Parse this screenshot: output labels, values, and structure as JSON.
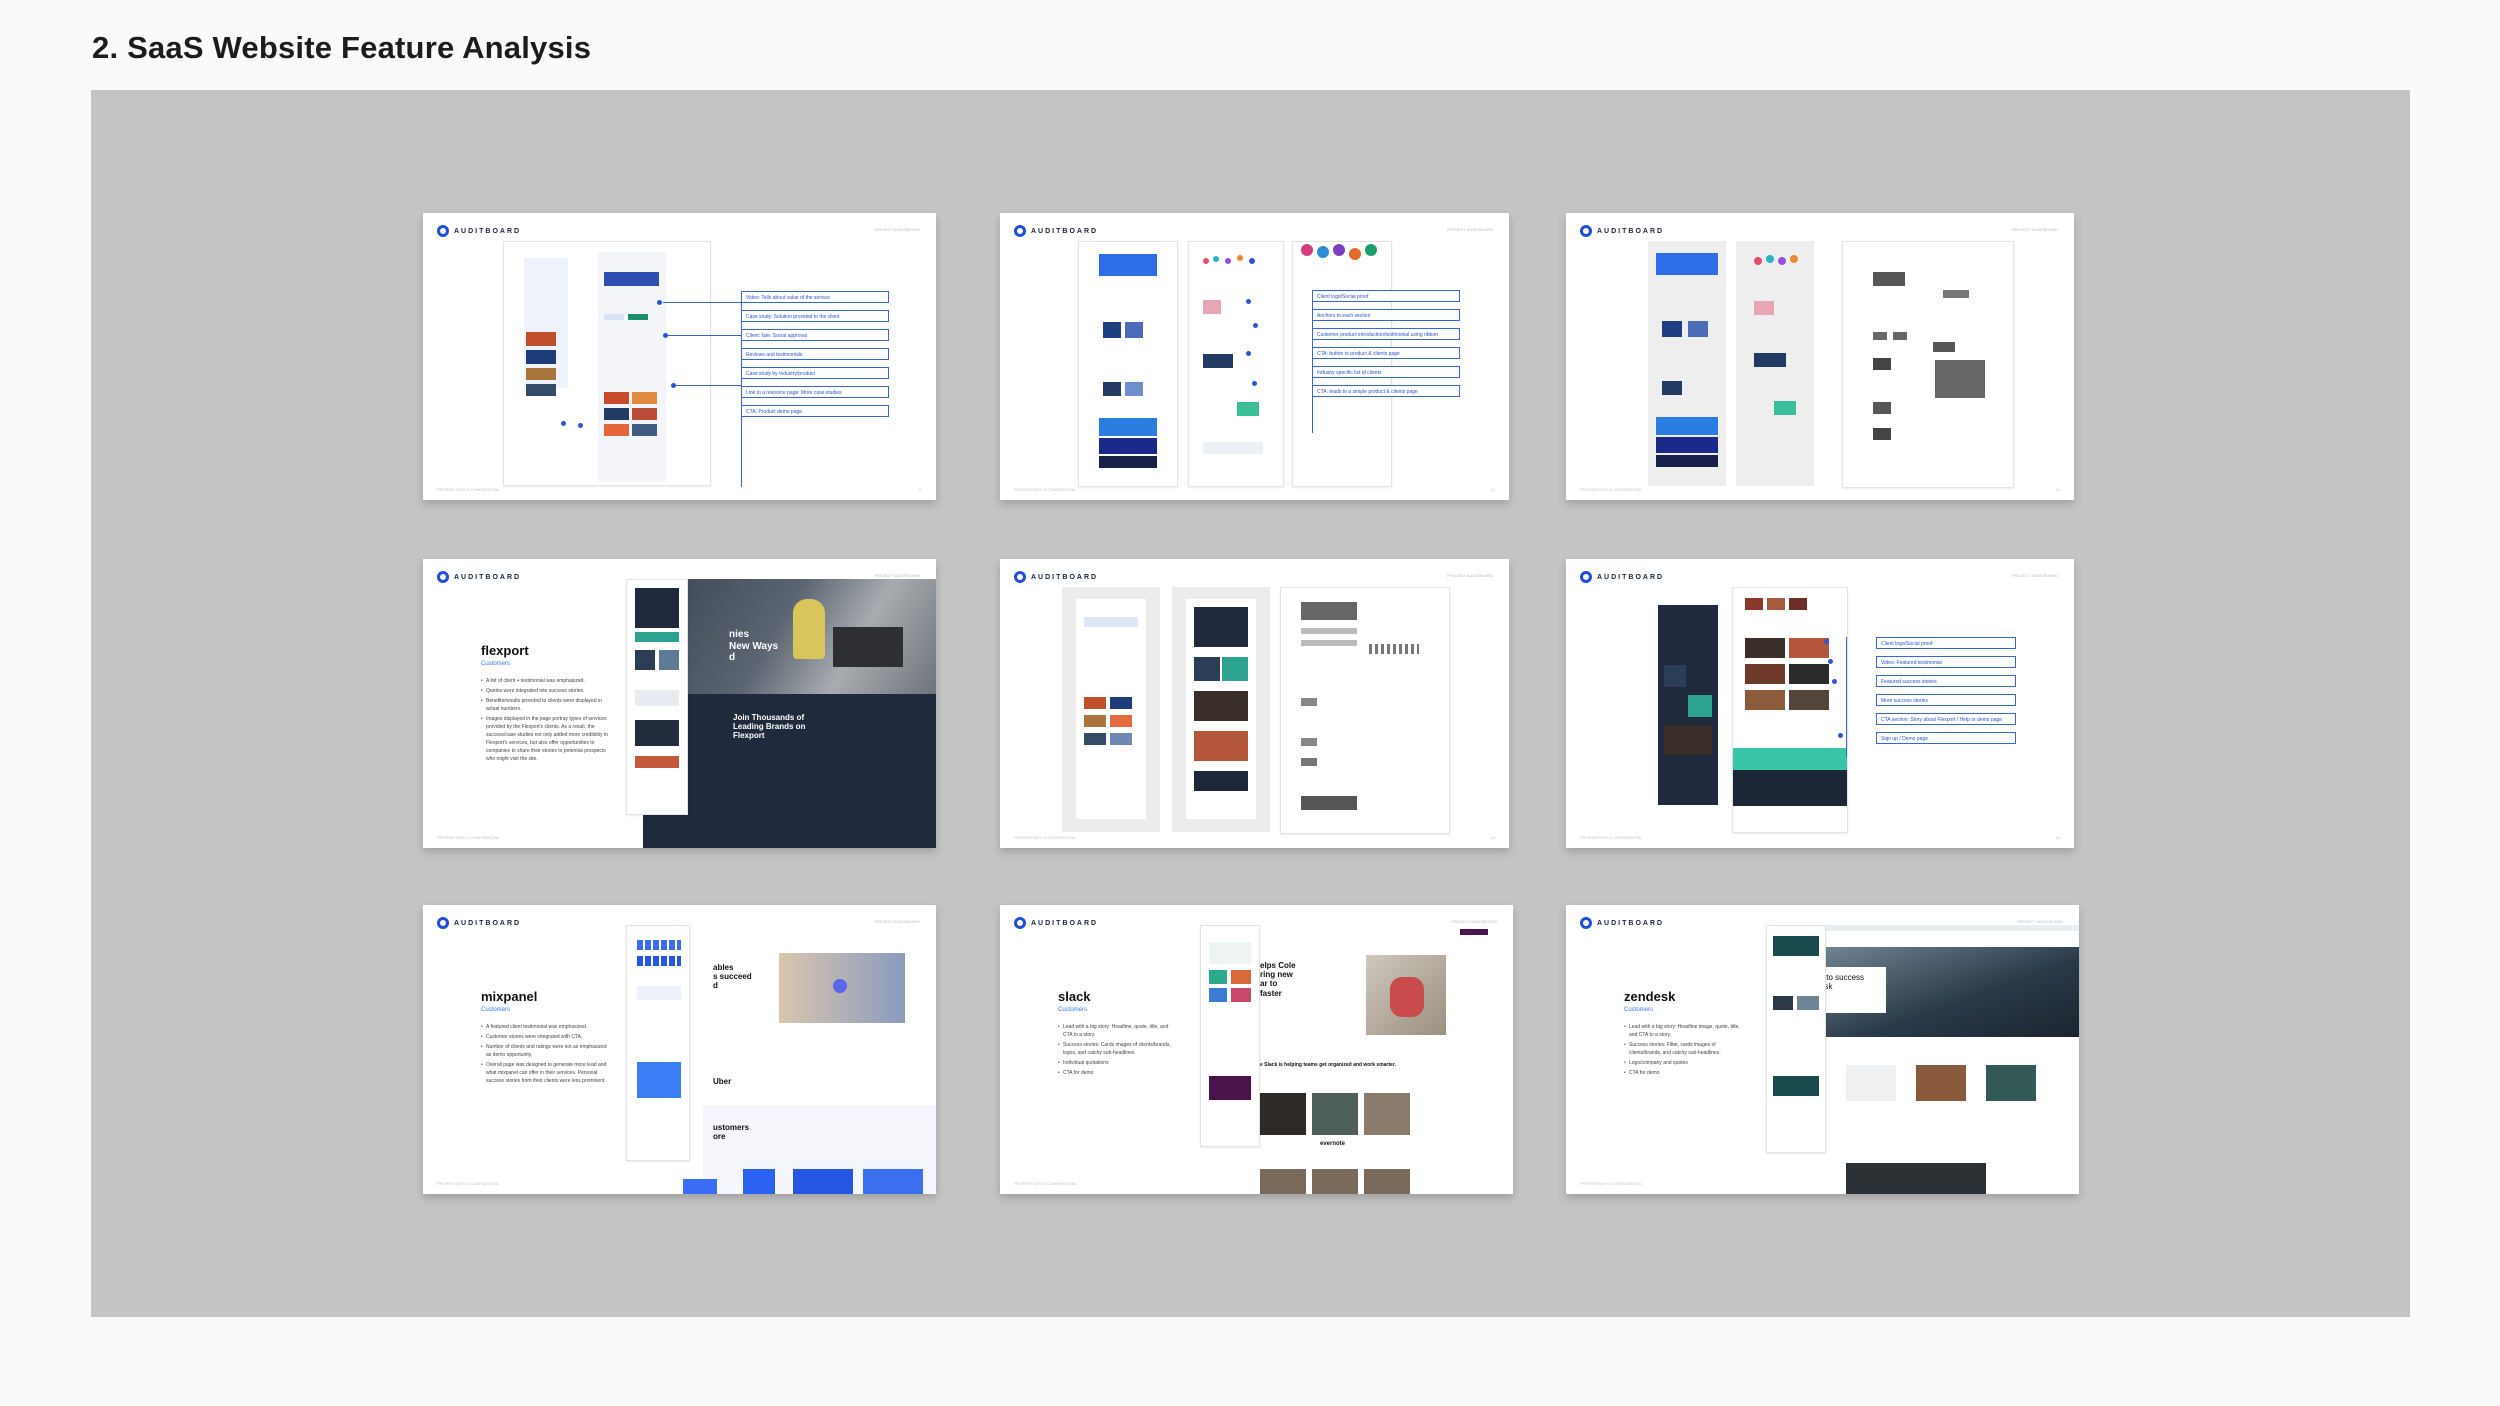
{
  "page": {
    "title": "2. SaaS Website Feature Analysis"
  },
  "slide_common": {
    "logo_text": "AUDITBOARD",
    "header_right": "PROJECT AUDITBOARD",
    "footer": "PROPRIETARY & CONFIDENTIAL"
  },
  "slides": {
    "s1": {
      "page_number": "11",
      "callouts": [
        "Video: Tells about value of the service",
        "Case study: Solution provided to the client",
        "Client: fate: Social approval",
        "Reviews and testimonials",
        "Case study by Industry/product",
        "Link to a resource page: More case studies",
        "CTA: Product demo page"
      ]
    },
    "s2": {
      "page_number": "12",
      "callouts": [
        "Client logo/Social proof",
        "Anchors to each section",
        "Customer product introduction/testimonial using ribbon",
        "CTA: button to product & clients page",
        "Industry specific list of clients",
        "CTA: leads to a simple product & clients page"
      ]
    },
    "s3": {
      "page_number": "13"
    },
    "s4": {
      "page_number": "14",
      "brand": "flexport",
      "subtitle": "Customers",
      "bullets": [
        "A list of client + testimonial was emphasized.",
        "Quotes were integrated into success stories.",
        "Benefits/results provided to clients were displayed in actual numbers.",
        "Images displayed in the page portray types of services provided by the Flexport's clients. As a result, the success/case studies not only added more credibility to Flexport's services, but also offer opportunities to companies to share their stories to potential prospects who might visit the site."
      ],
      "hero_text": "nies\nNew Ways\nd",
      "join_text": "Join Thousands of\nLeading Brands on\nFlexport"
    },
    "s5": {
      "page_number": "15"
    },
    "s6": {
      "page_number": "16",
      "callouts": [
        "Client logo/Social proof",
        "Video: Featured testimonial",
        "Featured success stories",
        "More success stories",
        "CTA section: Story about Flexport / Help or demo page",
        "Sign up / Demo page"
      ]
    },
    "s7": {
      "page_number": "17",
      "brand": "mixpanel",
      "subtitle": "Customers",
      "bullets": [
        "A featured client testimonial was emphasized.",
        "Customer stories were integrated with CTA.",
        "Number of clients and ratings were not as emphasized as demo opportunity.",
        "Overall page was designed to generate more lead and what mixpanel can offer in their services. Personal success stories from their clients were less prominent."
      ],
      "hero_text": "ables\ns succeed\nd",
      "stories_text": "ustomers\nore",
      "uber": "Uber"
    },
    "s8": {
      "page_number": "18",
      "brand": "slack",
      "subtitle": "Customers",
      "bullets": [
        "Lead with a big story: Headline, quote, title, and CTA to a story.",
        "Success stories: Cards images of clients/brands, logos, and catchy sub-headlines.",
        "Individual quotations",
        "CTA for demo"
      ],
      "hero_text": "elps Cole\nring new\nar to\nfaster",
      "helping_text": "e Slack is helping teams get organized and work smarter.",
      "evernote": "evernote"
    },
    "s9": {
      "page_number": "19",
      "brand": "zendesk",
      "subtitle": "Customers",
      "bullets": [
        "Lead with a big story: Headline image, quote, title, and CTA to a story.",
        "Success stories: Filter, cards images of clients/brands, and catchy sub-headlines.",
        "Logo/company and quotes",
        "CTA for demo"
      ],
      "hero_text": "y to success\nesk"
    }
  },
  "colors": {
    "accent": "#2b55d9",
    "board": "#c4c4c4",
    "dark_navy": "#1f2a3c"
  }
}
